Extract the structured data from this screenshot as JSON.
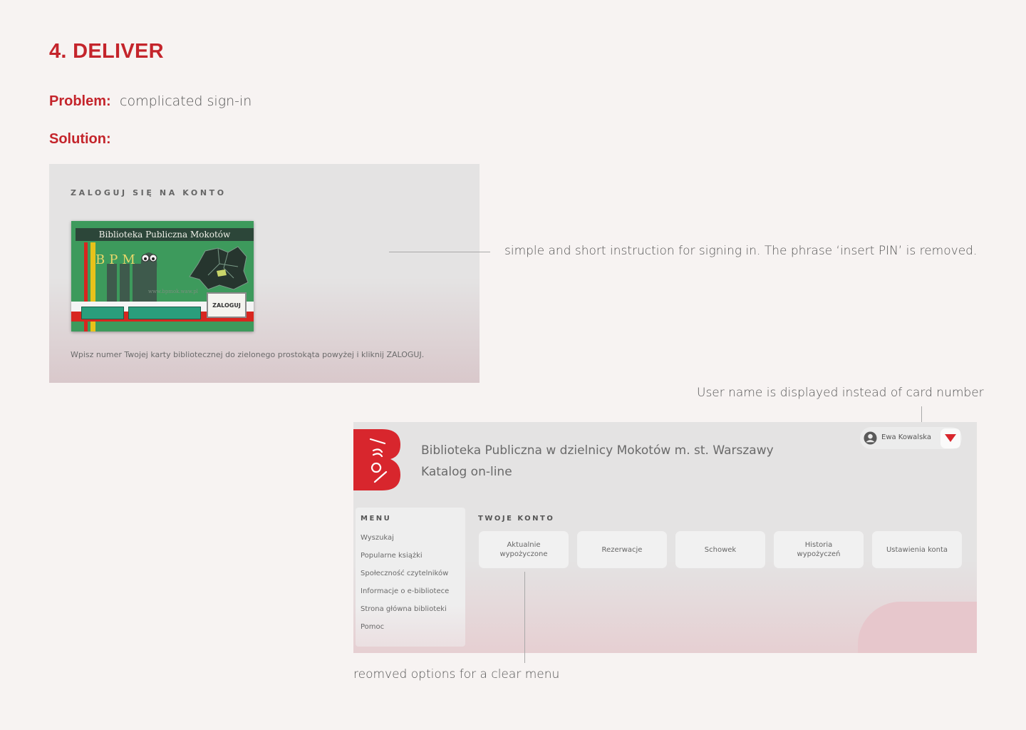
{
  "slide": {
    "title": "4. DELIVER",
    "problem_label": "Problem:",
    "problem_text": "complicated sign-in",
    "solution_label": "Solution:"
  },
  "login": {
    "heading": "ZALOGUJ SIĘ NA KONTO",
    "card_title": "Biblioteka Publiczna Mokotów",
    "card_letters": "BPM",
    "card_url": "www.bpmok.waw.pl",
    "login_button": "ZALOGUJ",
    "instruction": "Wpisz numer Twojej karty bibliotecznej do zielonego prostokąta powyżej i kliknij ZALOGUJ."
  },
  "annotations": {
    "instruction_note": "simple and short instruction for signing in. The phrase ‘insert PIN’ is removed.",
    "username_note": "User name is displayed instead of card number",
    "menu_note": "reomved options for a clear menu"
  },
  "catalog": {
    "library_title": "Biblioteka Publiczna w dzielnicy Mokotów m. st. Warszawy",
    "subtitle": "Katalog on-line",
    "user_name": "Ewa Kowalska",
    "menu_title": "MENU",
    "menu_items": [
      "Wyszukaj",
      "Popularne książki",
      "Społeczność czytelników",
      "Informacje o e-bibliotece",
      "Strona główna biblioteki",
      "Pomoc"
    ],
    "account_title": "TWOJE KONTO",
    "account_buttons": [
      "Aktualnie wypożyczone",
      "Rezerwacje",
      "Schowek",
      "Historia wypożyczeń",
      "Ustawienia konta"
    ]
  },
  "colors": {
    "accent": "#c4242b",
    "panel_bg": "#e4e3e3",
    "card_green": "#3d9a5c"
  }
}
